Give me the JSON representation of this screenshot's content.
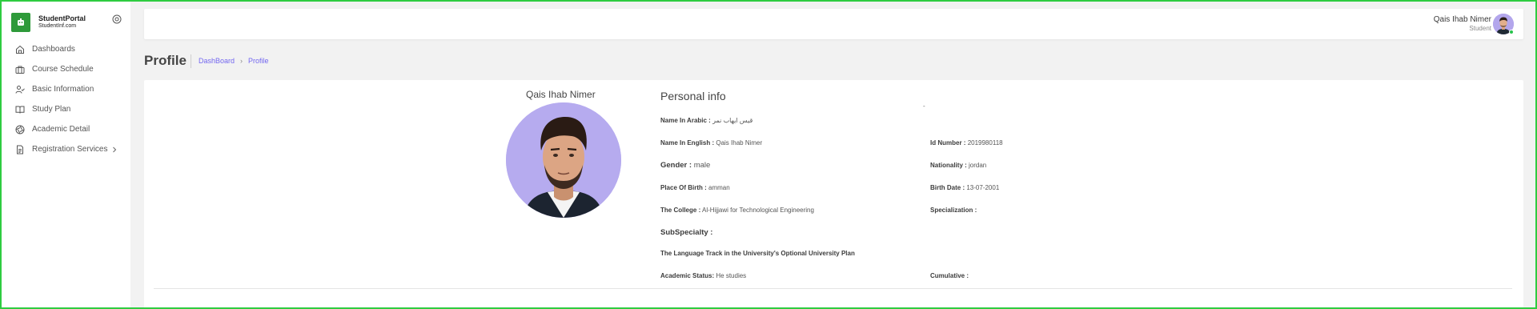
{
  "brand": {
    "name": "StudentPortal",
    "subtitle": "StudentInf.com"
  },
  "sidebar": {
    "items": [
      {
        "label": "Dashboards",
        "icon": "home-icon"
      },
      {
        "label": "Course Schedule",
        "icon": "briefcase-icon"
      },
      {
        "label": "Basic Information",
        "icon": "user-check-icon"
      },
      {
        "label": "Study Plan",
        "icon": "book-open-icon"
      },
      {
        "label": "Academic Detail",
        "icon": "aperture-icon"
      },
      {
        "label": "Registration Services",
        "icon": "file-text-icon"
      }
    ]
  },
  "header": {
    "user_name": "Qais Ihab Nimer",
    "user_role": "Student"
  },
  "page": {
    "title": "Profile",
    "breadcrumb": [
      "DashBoard",
      "Profile"
    ],
    "breadcrumb_sep": "›"
  },
  "profile": {
    "name": "Qais Ihab Nimer",
    "heading": "Personal info",
    "dash": "-",
    "fields": {
      "name_arabic": {
        "label": "Name In Arabic :",
        "value": "قيس ايهاب نمر"
      },
      "name_english": {
        "label": "Name In English :",
        "value": "Qais Ihab Nimer"
      },
      "id_number": {
        "label": "Id Number :",
        "value": "2019980118"
      },
      "gender": {
        "label": "Gender :",
        "value": "male"
      },
      "nationality": {
        "label": "Nationality :",
        "value": "jordan"
      },
      "place_of_birth": {
        "label": "Place Of Birth :",
        "value": "amman"
      },
      "birth_date": {
        "label": "Birth Date :",
        "value": "13-07-2001"
      },
      "college": {
        "label": "The College :",
        "value": "Al-Hijjawi for Technological Engineering"
      },
      "specialization": {
        "label": "Specialization :",
        "value": ""
      },
      "subspecialty": {
        "label": "SubSpecialty :",
        "value": ""
      },
      "language_track": {
        "label": "The Language Track in the University's Optional University Plan",
        "value": ""
      },
      "academic_status": {
        "label": "Academic Status:",
        "value": "He studies"
      },
      "cumulative": {
        "label": "Cumulative :",
        "value": ""
      }
    }
  },
  "colors": {
    "accent": "#7367f0",
    "brand_green": "#2e9a3a",
    "avatar_bg": "#b6abef",
    "frame": "#2ecc40"
  }
}
